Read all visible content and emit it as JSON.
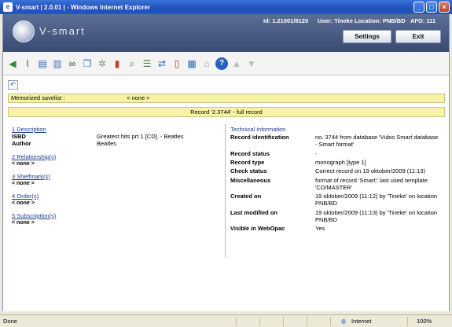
{
  "window": {
    "title": "V-smart | 2.0.01 | - Windows Internet Explorer"
  },
  "header": {
    "logo_text": "V-smart",
    "id_label": "Id: 1.21001/8120",
    "user_label": "User: Tineke",
    "location_label": "Location: PNB/BD",
    "afo_label": "AFO: 111",
    "settings_label": "Settings",
    "exit_label": "Exit"
  },
  "toolbar": {
    "icons": [
      "arrow-left-icon",
      "paperclip-icon",
      "books-icon",
      "trash-icon",
      "binoculars-icon",
      "copy-icon",
      "gear-icon",
      "bar-chart-icon",
      "search-doc-icon",
      "list-doc-icon",
      "transfer-icon",
      "book-open-icon",
      "book-stack-icon",
      "building-icon",
      "help-icon",
      "arrow-up-icon",
      "arrow-down-icon"
    ]
  },
  "savelist": {
    "label": "Memorized savelist :",
    "value": "< none >"
  },
  "record": {
    "title": "Record '2.3744' - full record"
  },
  "left": {
    "description": {
      "heading": "1 Description",
      "isbd_label": "ISBD",
      "isbd_value": "Greatest hits prt 1 [CD]. - Beatles",
      "author_label": "Author",
      "author_value": "Beatles"
    },
    "relationships": {
      "heading": "2 Relationship(s)",
      "value": "< none >"
    },
    "shelfmarks": {
      "heading": "3 Shelfmark(s)",
      "value": "< none >"
    },
    "orders": {
      "heading": "4 Order(s)",
      "value": "< none >"
    },
    "subscriptions": {
      "heading": "5 Subscription(s)",
      "value": "< none >"
    }
  },
  "right": {
    "heading": "Technical information",
    "rows": [
      {
        "label": "Record identification",
        "value": "no. 3744 from database 'Vubis Smart database - Smart format'"
      },
      {
        "label": "Record status",
        "value": "-"
      },
      {
        "label": "Record type",
        "value": "monograph [type 1]"
      },
      {
        "label": "Check status",
        "value": "Correct record on 19 oktober/2009 (11:13)"
      },
      {
        "label": "Miscellaneous",
        "value": "format of record 'Smart'; last used template 'CD/MASTER'"
      },
      {
        "label": "Created on",
        "value": "19 oktober/2009 (11:12) by 'Tineke' on location PNB/BD"
      },
      {
        "label": "Last modified on",
        "value": "19 oktober/2009 (11:13) by 'Tineke' on location PNB/BD"
      },
      {
        "label": "Visible in WebOpac",
        "value": "Yes"
      }
    ]
  },
  "statusbar": {
    "status": "Done",
    "zone": "Internet",
    "zoom": "100%"
  }
}
